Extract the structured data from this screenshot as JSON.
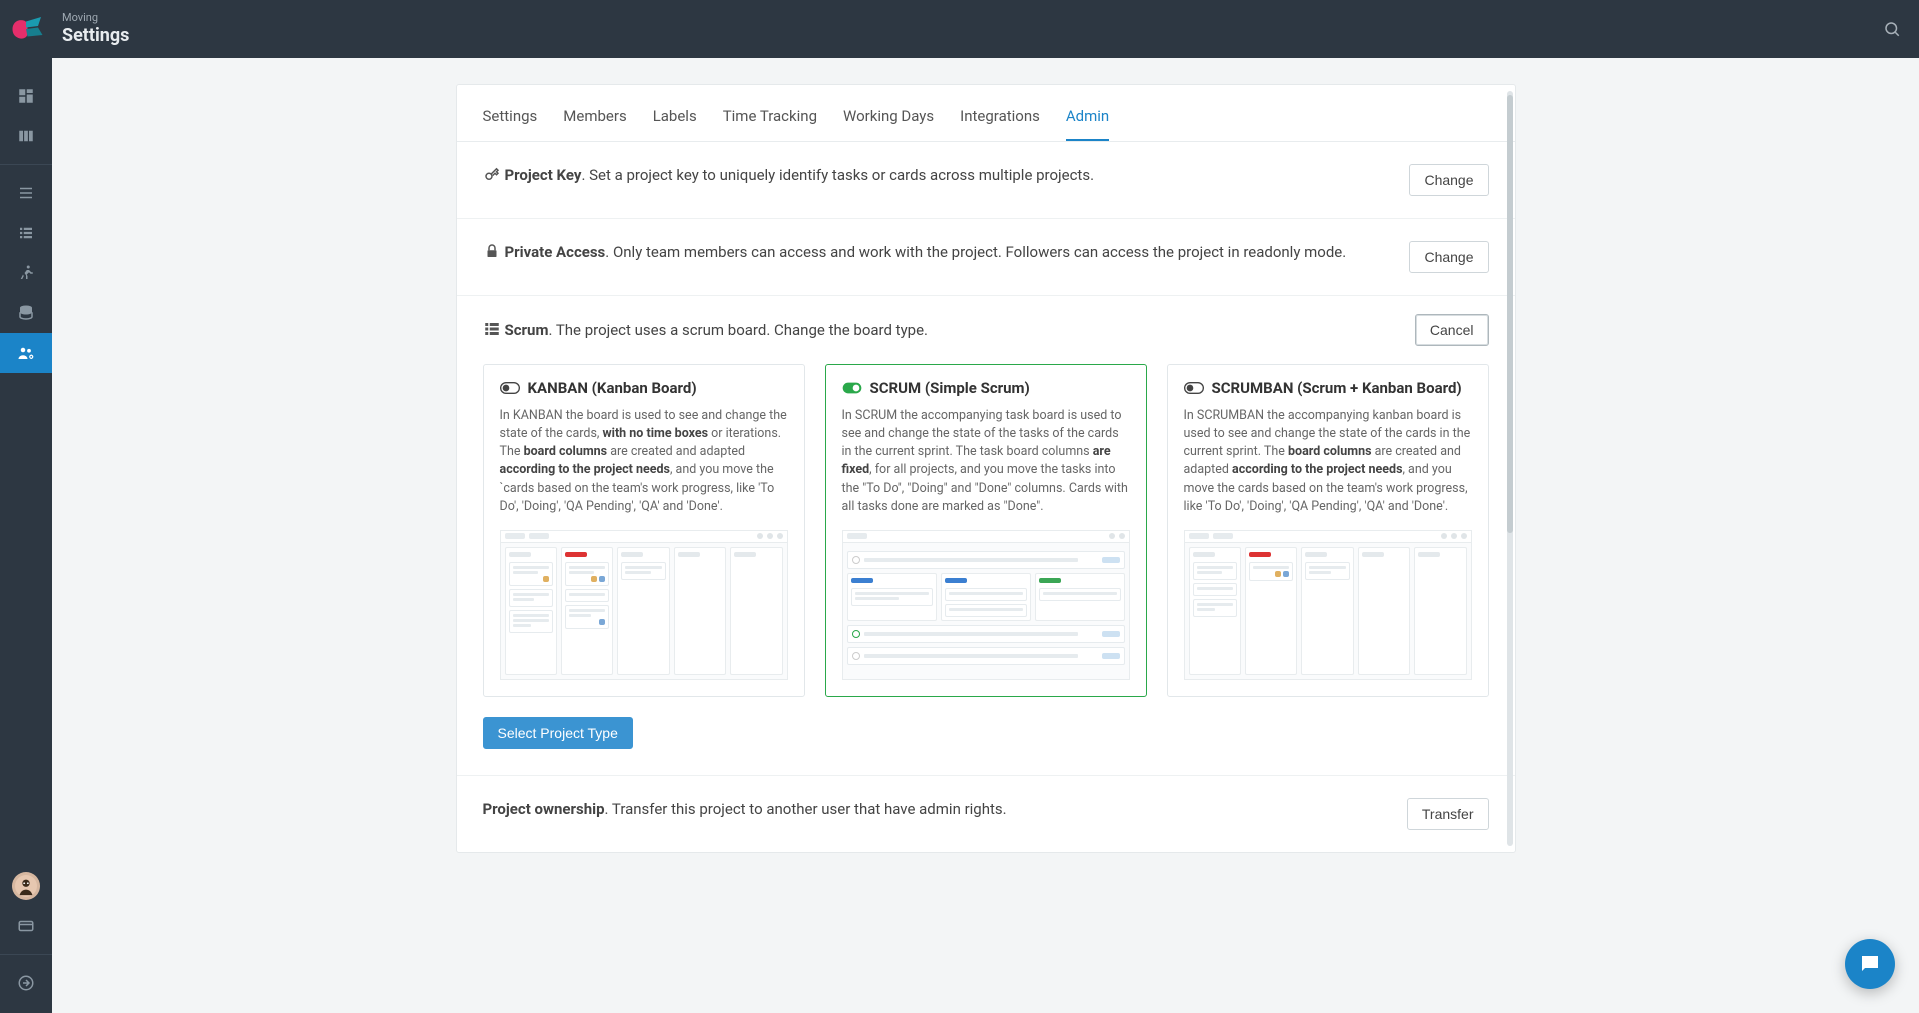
{
  "header": {
    "breadcrumb": "Moving",
    "title": "Settings"
  },
  "tabs": [
    {
      "label": "Settings",
      "active": false
    },
    {
      "label": "Members",
      "active": false
    },
    {
      "label": "Labels",
      "active": false
    },
    {
      "label": "Time Tracking",
      "active": false
    },
    {
      "label": "Working Days",
      "active": false
    },
    {
      "label": "Integrations",
      "active": false
    },
    {
      "label": "Admin",
      "active": true
    }
  ],
  "sections": {
    "project_key": {
      "title": "Project Key",
      "desc": ". Set a project key to uniquely identify tasks or cards across multiple projects.",
      "button": "Change"
    },
    "private_access": {
      "title": "Private Access",
      "desc": ". Only team members can access and work with the project. Followers can access the project in readonly mode.",
      "button": "Change"
    },
    "scrum": {
      "title": "Scrum",
      "desc": ". The project uses a scrum board. Change the board type.",
      "button": "Cancel"
    },
    "ownership": {
      "title": "Project ownership",
      "desc": ". Transfer this project to another user that have admin rights.",
      "button": "Transfer"
    }
  },
  "board_options": {
    "kanban": {
      "title": "KANBAN (Kanban Board)",
      "desc_parts": [
        "In KANBAN the board is used to see and change the state of the cards, ",
        "with no time boxes",
        " or iterations. The ",
        "board columns",
        " are created and adapted ",
        "according to the project needs",
        ", and you move the `cards based on the team's work progress, like 'To Do', 'Doing', 'QA Pending', 'QA' and 'Done'."
      ]
    },
    "scrum": {
      "title": "SCRUM (Simple Scrum)",
      "desc_parts": [
        "In SCRUM the accompanying task board is used to see and change the state of the tasks of the cards in the current sprint. The task board columns ",
        "are fixed",
        ", for all projects, and you move the tasks into the \"To Do\", \"Doing\" and \"Done\" columns. Cards with all tasks done are marked as \"Done\"."
      ]
    },
    "scrumban": {
      "title": "SCRUMBAN (Scrum + Kanban Board)",
      "desc_parts": [
        "In SCRUMBAN the accompanying kanban board is used to see and change the state of the cards in the current sprint. The ",
        "board columns",
        " are created and adapted ",
        "according to the project needs",
        ", and you move the cards based on the team's work progress, like 'To Do', 'Doing', 'QA Pending', 'QA' and 'Done'."
      ]
    },
    "select_button": "Select Project Type"
  },
  "sidebar_icons": [
    "dashboard",
    "board",
    "lines",
    "list",
    "run",
    "db",
    "team"
  ],
  "colors": {
    "accent": "#1b84c8"
  }
}
